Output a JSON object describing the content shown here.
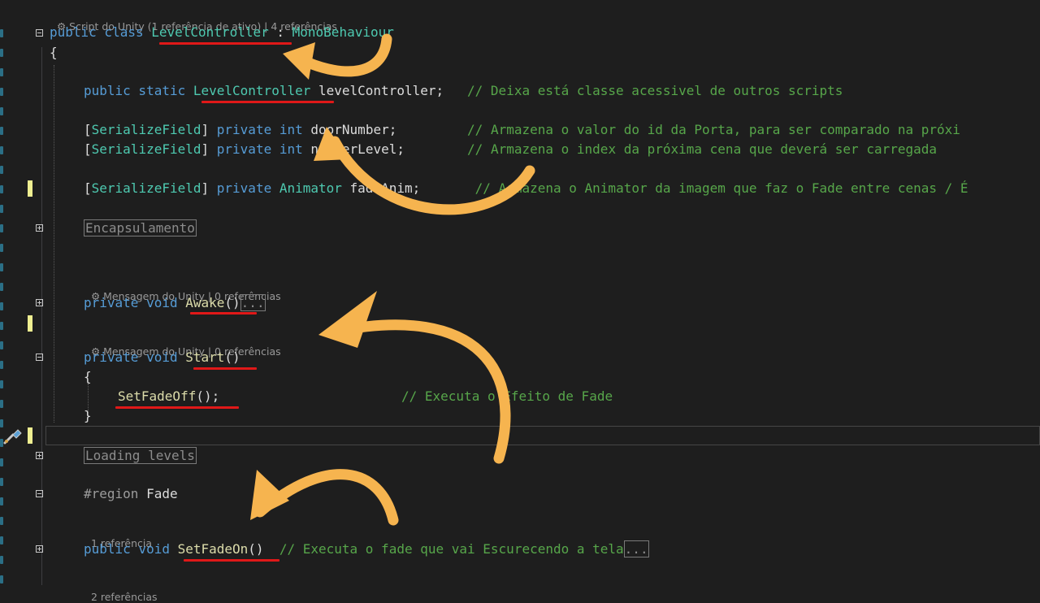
{
  "editor": {
    "hints": {
      "class": "Script do Unity (1 referência de ativo) | 4 referências",
      "awake": "Mensagem do Unity | 0 referências",
      "start": "Mensagem do Unity | 0 referências",
      "setFadeOn": "1 referência",
      "bottom": "2 referências"
    },
    "code": {
      "class_kw": "public class ",
      "class_name": "LevelController",
      "class_colon": " : ",
      "class_base": "MonoBehaviour",
      "brace_open": "{",
      "brace_close": "}",
      "l5_kw": "public static ",
      "l5_type": "LevelController",
      "l5_rest": " levelController;   ",
      "l5_comment": "// Deixa está classe acessivel de outros scripts",
      "attr": "SerializeField",
      "l7_private": " private ",
      "l7_type": "int",
      "l7_rest": " doorNumber;         ",
      "l7_comment": "// Armazena o valor do id da Porta, para ser comparado na próxi",
      "l8_rest": " numberLevel;        ",
      "l8_comment": "// Armazena o index da próxima cena que deverá ser carregada",
      "l10_type": "Animator",
      "l10_rest": " fadeAnim;       ",
      "l10_comment": "// Armazena o Animator da imagem que faz o Fade entre cenas / É",
      "region1": "Encapsulamento",
      "private_void": "private void ",
      "awake_name": "Awake",
      "parens": "()",
      "ellipsis": "...",
      "start_name": "Start",
      "setfadeoff_call": "SetFadeOff",
      "setfadeoff_end": "();",
      "setfadeoff_comment": "// Executa o Efeito de Fade",
      "region2": "Loading levels",
      "region3_kw": "#region ",
      "region3_name": "Fade",
      "public_void": "public void ",
      "setfadeon_name": "SetFadeOn",
      "setfadeon_comment": "// Executa o fade que vai Escurecendo a tela"
    }
  },
  "colors": {
    "background": "#1e1e1e",
    "keyword": "#569cd6",
    "type": "#4ec9b0",
    "comment": "#57a64a",
    "method": "#dcdcaa",
    "underline": "#e01818",
    "arrow": "#f6b44f",
    "change_marker": "#efef91"
  },
  "icons": [
    "unity-icon",
    "fold-minus-icon",
    "fold-plus-icon",
    "quick-action-brush-icon"
  ]
}
